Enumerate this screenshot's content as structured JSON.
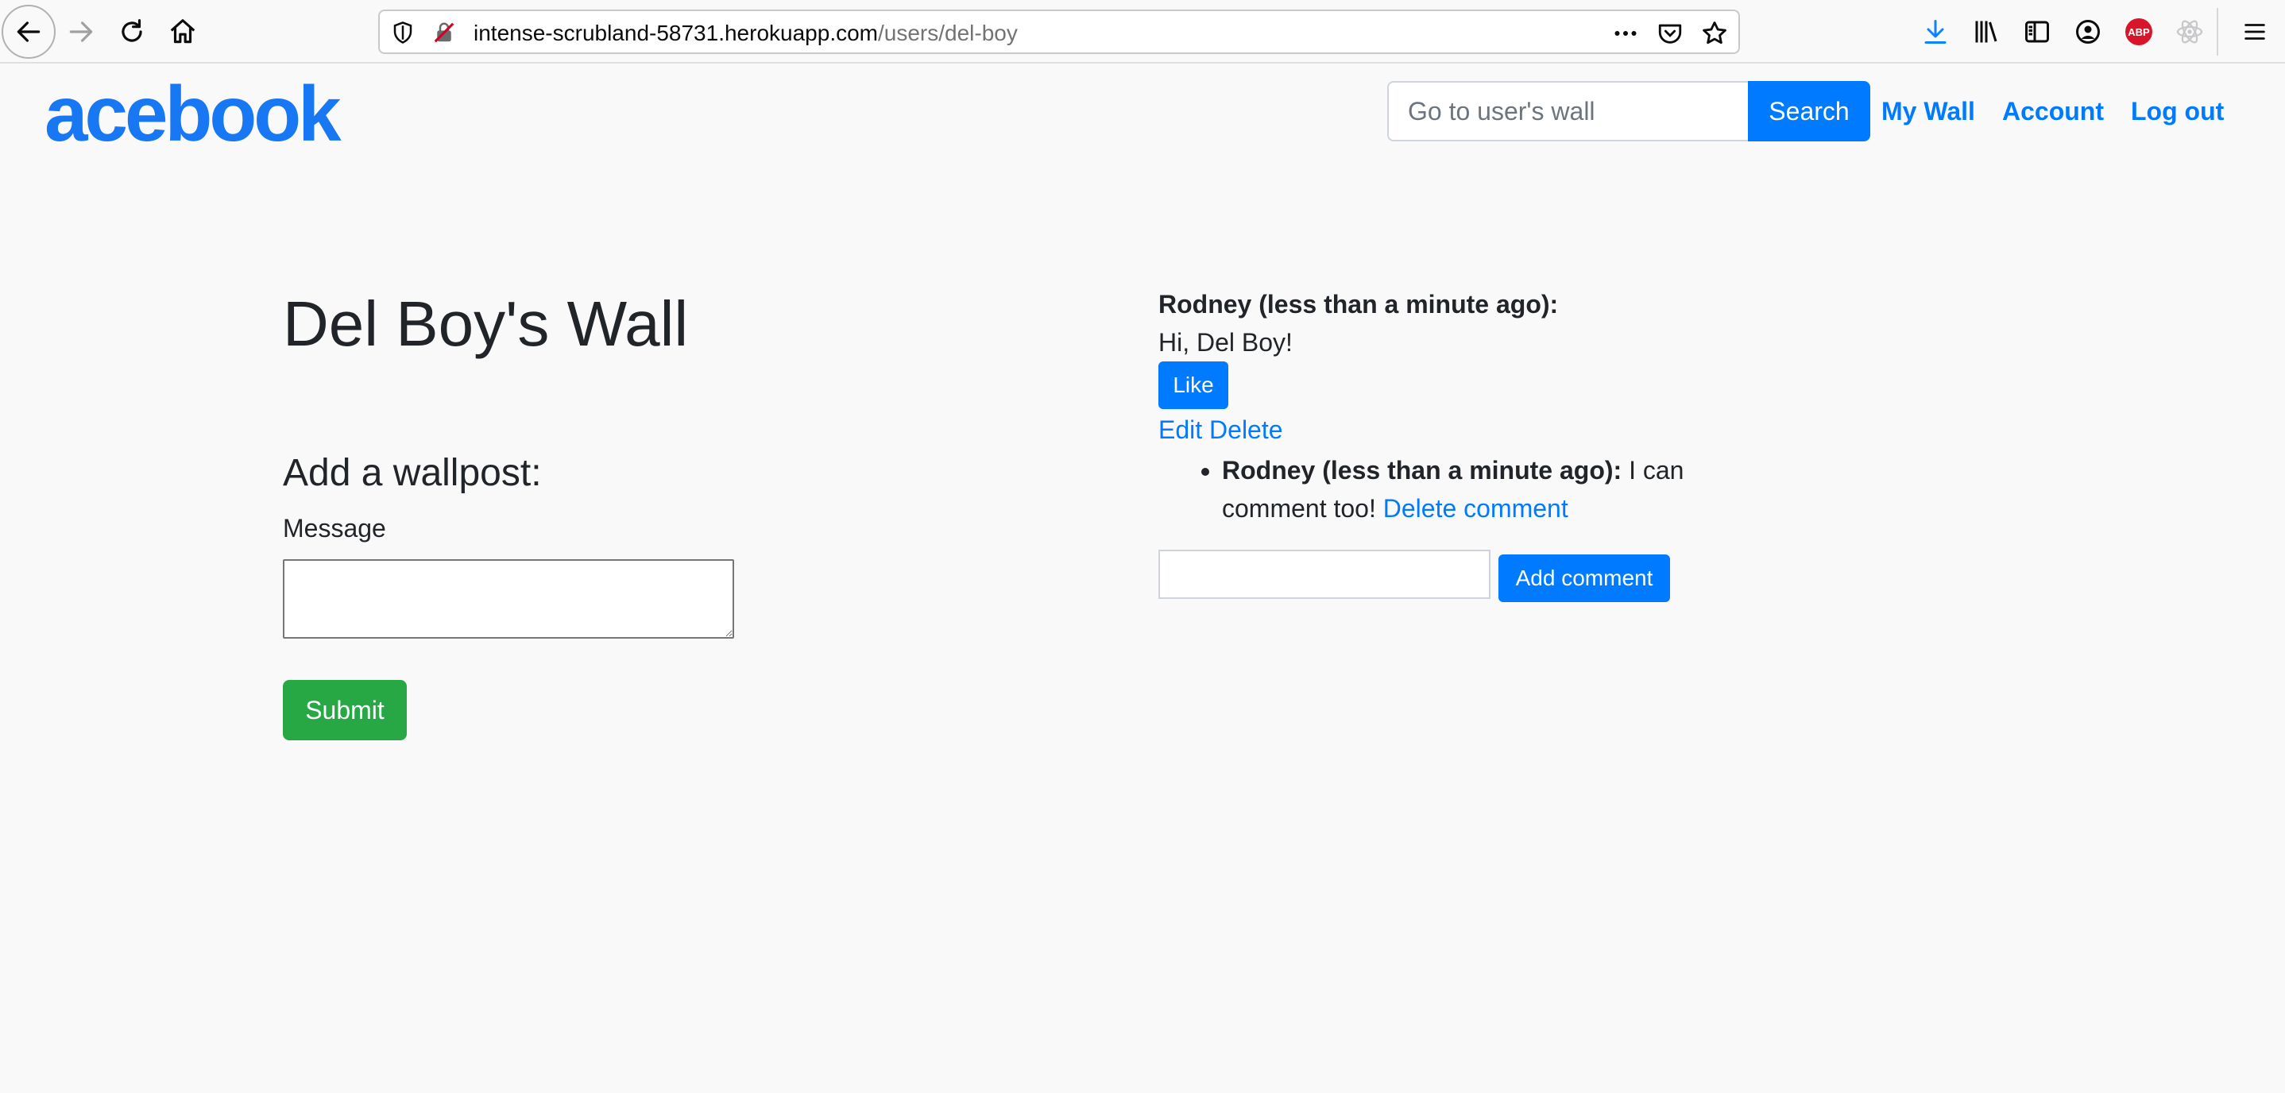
{
  "browser": {
    "url_host": "intense-scrubland-58731.herokuapp.com",
    "url_path": "/users/del-boy",
    "abp_label": "ABP"
  },
  "header": {
    "brand": "acebook",
    "search_placeholder": "Go to user's wall",
    "search_label": "Search",
    "links": {
      "my_wall": "My Wall",
      "account": "Account",
      "log_out": "Log out"
    }
  },
  "wall": {
    "title": "Del Boy's Wall",
    "form_heading": "Add a wallpost:",
    "message_label": "Message",
    "submit_label": "Submit"
  },
  "post": {
    "author_line": "Rodney (less than a minute ago):",
    "body": "Hi, Del Boy!",
    "like_label": "Like",
    "edit_label": "Edit",
    "delete_label": "Delete",
    "comments": [
      {
        "author_line": "Rodney (less than a minute ago):",
        "text": " I can comment too! ",
        "delete_label": "Delete comment"
      }
    ],
    "add_comment_label": "Add comment"
  },
  "colors": {
    "primary": "#007bff",
    "success": "#28a745",
    "brand": "#1877f2",
    "background": "#f9f9f9"
  }
}
